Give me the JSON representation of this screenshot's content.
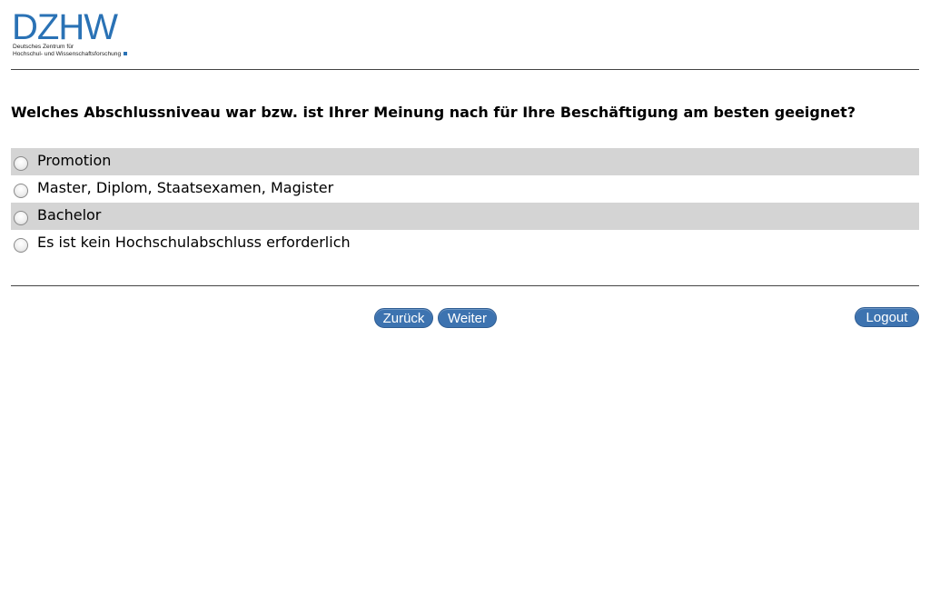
{
  "logo": {
    "main": "DZHW",
    "line1": "Deutsches Zentrum für",
    "line2": "Hochschul- und Wissenschaftsforschung"
  },
  "question": "Welches Abschlussniveau war bzw. ist Ihrer Meinung nach für Ihre Beschäftigung am besten geeignet?",
  "options": [
    {
      "label": "Promotion"
    },
    {
      "label": "Master, Diplom, Staatsexamen, Magister"
    },
    {
      "label": "Bachelor"
    },
    {
      "label": "Es ist kein Hochschulabschluss erforderlich"
    }
  ],
  "nav": {
    "back_label": "Zurück",
    "next_label": "Weiter",
    "logout_label": "Logout"
  },
  "colors": {
    "accent": "#3d73b0",
    "brand": "#2a72b5",
    "row_shade": "#d4d4d4"
  }
}
